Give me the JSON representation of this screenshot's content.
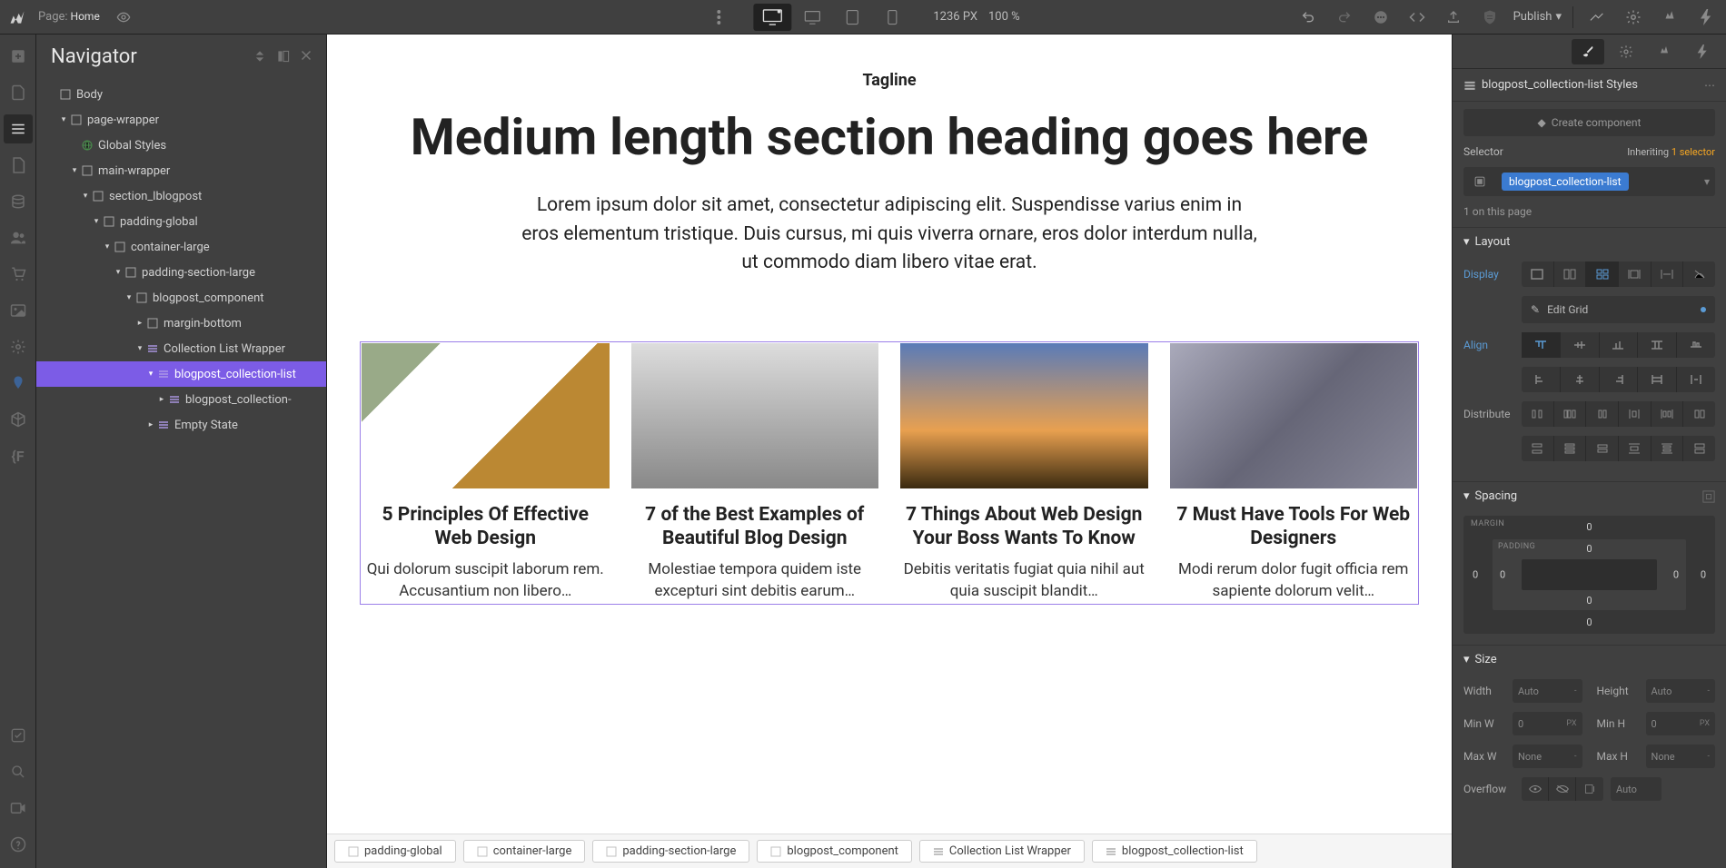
{
  "topbar": {
    "page_label": "Page:",
    "page_name": "Home",
    "width": "1236",
    "width_unit": "PX",
    "zoom": "100",
    "zoom_unit": "%",
    "publish": "Publish"
  },
  "navigator": {
    "title": "Navigator",
    "tree": [
      {
        "label": "Body",
        "indent": 0,
        "toggle": "",
        "icon": "body"
      },
      {
        "label": "page-wrapper",
        "indent": 1,
        "toggle": "▾",
        "icon": "div"
      },
      {
        "label": "Global Styles",
        "indent": 2,
        "toggle": "",
        "icon": "globe"
      },
      {
        "label": "main-wrapper",
        "indent": 2,
        "toggle": "▾",
        "icon": "div"
      },
      {
        "label": "section_lblogpost",
        "indent": 3,
        "toggle": "▾",
        "icon": "div"
      },
      {
        "label": "padding-global",
        "indent": 4,
        "toggle": "▾",
        "icon": "div"
      },
      {
        "label": "container-large",
        "indent": 5,
        "toggle": "▾",
        "icon": "div"
      },
      {
        "label": "padding-section-large",
        "indent": 6,
        "toggle": "▾",
        "icon": "div"
      },
      {
        "label": "blogpost_component",
        "indent": 7,
        "toggle": "▾",
        "icon": "div"
      },
      {
        "label": "margin-bottom",
        "indent": 8,
        "toggle": "▸",
        "icon": "div"
      },
      {
        "label": "Collection List Wrapper",
        "indent": 8,
        "toggle": "▾",
        "icon": "cms"
      },
      {
        "label": "blogpost_collection-list",
        "indent": 9,
        "toggle": "▾",
        "icon": "cms",
        "selected": true
      },
      {
        "label": "blogpost_collection-",
        "indent": 10,
        "toggle": "▸",
        "icon": "cms"
      },
      {
        "label": "Empty State",
        "indent": 9,
        "toggle": "▸",
        "icon": "cms"
      }
    ]
  },
  "canvas": {
    "tagline": "Tagline",
    "heading": "Medium length section heading goes here",
    "lede": "Lorem ipsum dolor sit amet, consectetur adipiscing elit. Suspendisse varius enim in eros elementum tristique. Duis cursus, mi quis viverra ornare, eros dolor interdum nulla, ut commodo diam libero vitae erat.",
    "posts": [
      {
        "title": "5 Principles Of Effective Web Design",
        "excerpt": "Qui dolorum suscipit laborum rem. Accusantium non libero…"
      },
      {
        "title": "7 of the Best Examples of Beautiful Blog Design",
        "excerpt": "Molestiae tempora quidem iste excepturi sint debitis earum…"
      },
      {
        "title": "7 Things About Web Design Your Boss Wants To Know",
        "excerpt": "Debitis veritatis fugiat quia nihil aut quia suscipit blandit…"
      },
      {
        "title": "7 Must Have Tools For Web Designers",
        "excerpt": "Modi rerum dolor fugit officia rem sapiente dolorum velit…"
      }
    ]
  },
  "breadcrumb": [
    {
      "label": "padding-global",
      "icon": "div"
    },
    {
      "label": "container-large",
      "icon": "div"
    },
    {
      "label": "padding-section-large",
      "icon": "div"
    },
    {
      "label": "blogpost_component",
      "icon": "div"
    },
    {
      "label": "Collection List Wrapper",
      "icon": "cms"
    },
    {
      "label": "blogpost_collection-list",
      "icon": "cms"
    }
  ],
  "style": {
    "title_suffix": "Styles",
    "element_name": "blogpost_collection-list",
    "create_component": "Create component",
    "selector_label": "Selector",
    "inheriting_text": "Inheriting",
    "inheriting_count": "1 selector",
    "selector_tag": "blogpost_collection-list",
    "on_page": "1 on this page",
    "layout_title": "Layout",
    "display_label": "Display",
    "edit_grid": "Edit Grid",
    "align_label": "Align",
    "distribute_label": "Distribute",
    "spacing_title": "Spacing",
    "margin_label": "MARGIN",
    "padding_label": "PADDING",
    "margin": {
      "top": "0",
      "right": "0",
      "bottom": "0",
      "left": "0"
    },
    "padding": {
      "top": "0",
      "right": "0",
      "bottom": "0",
      "left": "0"
    },
    "size_title": "Size",
    "size": {
      "width_label": "Width",
      "width_val": "Auto",
      "width_unit": "-",
      "height_label": "Height",
      "height_val": "Auto",
      "height_unit": "-",
      "minw_label": "Min W",
      "minw_val": "0",
      "minw_unit": "PX",
      "minh_label": "Min H",
      "minh_val": "0",
      "minh_unit": "PX",
      "maxw_label": "Max W",
      "maxw_val": "None",
      "maxw_unit": "-",
      "maxh_label": "Max H",
      "maxh_val": "None",
      "maxh_unit": "-"
    },
    "overflow_label": "Overflow",
    "overflow_auto": "Auto"
  }
}
